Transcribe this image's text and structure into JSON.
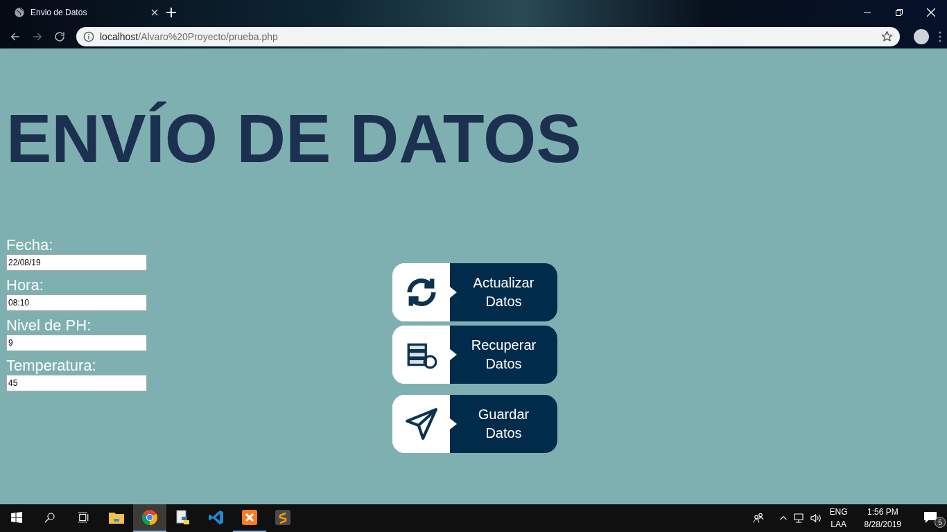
{
  "browser": {
    "tab": {
      "title": "Envio de Datos"
    },
    "url": {
      "host": "localhost",
      "path": "/Alvaro%20Proyecto/prueba.php"
    }
  },
  "page": {
    "heading": "ENVÍO DE DATOS",
    "fields": [
      {
        "label": "Fecha:",
        "value": "22/08/19"
      },
      {
        "label": "Hora:",
        "value": "08:10"
      },
      {
        "label": "Nivel de PH:",
        "value": "9"
      },
      {
        "label": "Temperatura:",
        "value": "45"
      }
    ],
    "buttons": [
      {
        "kind": "refresh",
        "label": "Actualizar Datos"
      },
      {
        "kind": "database",
        "label": "Recuperar Datos"
      },
      {
        "kind": "send",
        "label": "Guardar Datos"
      }
    ]
  },
  "taskbar": {
    "apps": [
      {
        "kind": "explorer",
        "active": false,
        "running": false
      },
      {
        "kind": "chrome",
        "active": true,
        "running": true
      },
      {
        "kind": "python",
        "active": false,
        "running": false
      },
      {
        "kind": "vscode",
        "active": false,
        "running": false
      },
      {
        "kind": "xampp",
        "active": false,
        "running": true
      },
      {
        "kind": "sublime",
        "active": false,
        "running": false
      }
    ],
    "tray": {
      "language": "ENG",
      "layout": "LAA",
      "time": "1:56 PM",
      "date": "8/28/2019",
      "notifications": "5"
    }
  }
}
